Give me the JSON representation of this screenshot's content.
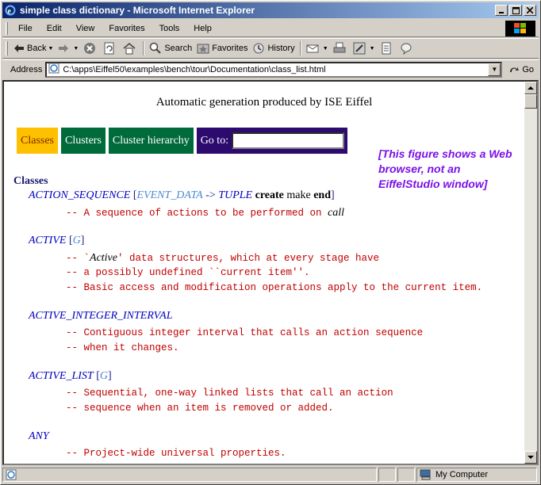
{
  "window": {
    "title": "simple class dictionary - Microsoft Internet Explorer"
  },
  "menu": [
    "File",
    "Edit",
    "View",
    "Favorites",
    "Tools",
    "Help"
  ],
  "toolbar": {
    "back": "Back",
    "search": "Search",
    "favorites": "Favorites",
    "history": "History"
  },
  "address": {
    "label": "Address",
    "url": "C:\\apps\\Eiffel50\\examples\\bench\\tour\\Documentation\\class_list.html",
    "go": "Go"
  },
  "page": {
    "generated": "Automatic generation produced by ISE Eiffel",
    "nav": {
      "classes": "Classes",
      "clusters": "Clusters",
      "hierarchy": "Cluster hierarchy",
      "goto": "Go to:"
    },
    "note": "[This figure shows a Web browser, not an EiffelStudio window]",
    "heading": "Classes",
    "entries": [
      {
        "name": "ACTION_SEQUENCE",
        "open": "[",
        "gen1": "EVENT_DATA",
        "arrow": " -> ",
        "tuple": "TUPLE",
        "create": "create",
        "make": " make ",
        "end": "end",
        "close": "]",
        "comments": [
          "-- A sequence of actions to be performed on ",
          "call"
        ]
      },
      {
        "name": "ACTIVE",
        "gen": "G",
        "comments": [
          "-- `",
          "Active",
          "' data structures, which at every stage have",
          "-- a possibly undefined ``current item''.",
          "-- Basic access and modification operations apply to the current item."
        ]
      },
      {
        "name": "ACTIVE_INTEGER_INTERVAL",
        "comments": [
          "-- Contiguous integer interval that calls an action sequence",
          "-- when it changes."
        ]
      },
      {
        "name": "ACTIVE_LIST",
        "gen": "G",
        "comments": [
          "-- Sequential, one-way linked lists that call an action",
          "-- sequence when an item is removed or added."
        ]
      },
      {
        "name": "ANY",
        "comments": [
          "-- Project-wide universal properties."
        ]
      }
    ]
  },
  "status": {
    "zone": "My Computer"
  }
}
